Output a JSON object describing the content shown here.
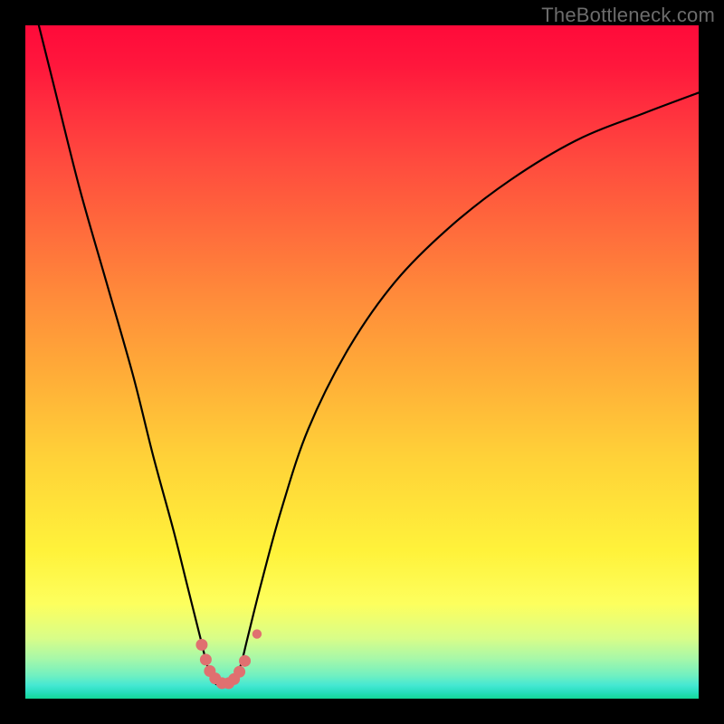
{
  "watermark": "TheBottleneck.com",
  "colors": {
    "background": "#000000",
    "curve_stroke": "#000000",
    "marker_fill": "#e07070",
    "gradient_top": "#ff0a3a",
    "gradient_bottom": "#13d898"
  },
  "chart_data": {
    "type": "line",
    "title": "",
    "xlabel": "",
    "ylabel": "",
    "xlim": [
      0,
      100
    ],
    "ylim": [
      0,
      100
    ],
    "grid": false,
    "legend": false,
    "series": [
      {
        "name": "bottleneck-curve",
        "x": [
          0,
          4,
          8,
          12,
          16,
          19,
          22,
          24,
          26,
          27,
          28,
          29,
          30,
          31,
          32,
          33,
          35,
          38,
          42,
          48,
          55,
          63,
          72,
          82,
          92,
          100
        ],
        "values": [
          108,
          92,
          76,
          62,
          48,
          36,
          25,
          17,
          9,
          5,
          2.5,
          2,
          2,
          2.7,
          5,
          9,
          17,
          28,
          40,
          52,
          62,
          70,
          77,
          83,
          87,
          90
        ]
      }
    ],
    "markers": {
      "name": "highlight-points",
      "x": [
        26.2,
        26.8,
        27.4,
        28.2,
        29.2,
        30.2,
        31.0,
        31.8,
        32.6,
        34.4
      ],
      "values": [
        8.0,
        5.8,
        4.1,
        3.0,
        2.3,
        2.3,
        2.9,
        4.0,
        5.6,
        9.6
      ],
      "radius": [
        6.5,
        6.5,
        6.5,
        6.5,
        6.5,
        6.5,
        6.5,
        6.5,
        6.5,
        5.2
      ]
    }
  }
}
